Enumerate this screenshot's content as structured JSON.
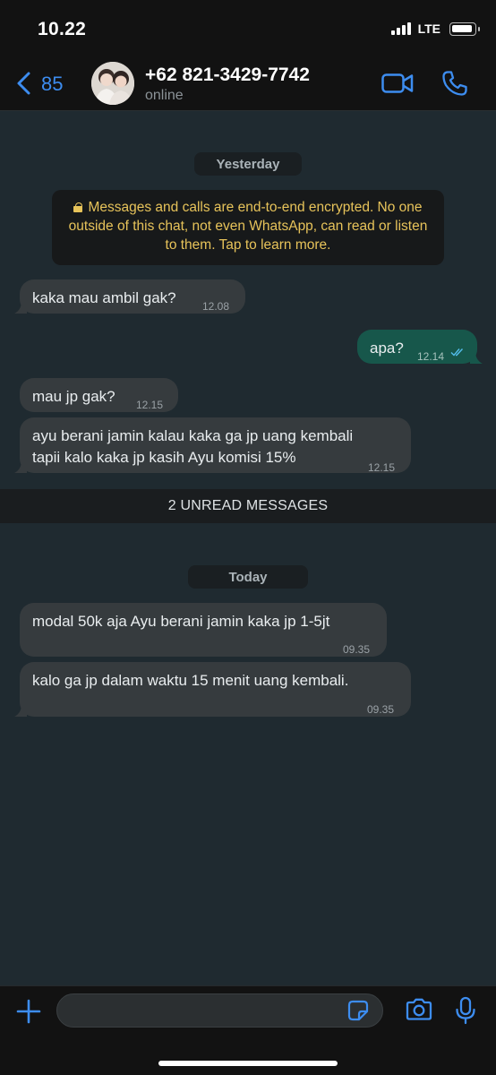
{
  "status_bar": {
    "time": "10.22",
    "network": "LTE"
  },
  "header": {
    "back_count": "85",
    "contact_name": "+62 821-3429-7742",
    "contact_status": "online",
    "icons": {
      "back": "chevron-left-icon",
      "video": "video-camera-icon",
      "call": "phone-icon"
    },
    "accent_color": "#3d8df0"
  },
  "chat": {
    "date_yesterday": "Yesterday",
    "encryption_notice": "Messages and calls are end-to-end encrypted. No one outside of this chat, not even WhatsApp, can read or listen to them. Tap to learn more.",
    "messages_yesterday": [
      {
        "direction": "in",
        "text": "kaka mau ambil gak?",
        "time": "12.08"
      },
      {
        "direction": "out",
        "text": "apa?",
        "time": "12.14",
        "status": "read"
      },
      {
        "direction": "in",
        "text": "mau jp gak?",
        "time": "12.15"
      },
      {
        "direction": "in",
        "lines": [
          "ayu berani jamin kalau kaka ga jp uang kembali",
          "tapii kalo kaka jp kasih Ayu komisi 15%"
        ],
        "time": "12.15"
      }
    ],
    "unread_banner": "2 UNREAD MESSAGES",
    "date_today": "Today",
    "messages_today": [
      {
        "direction": "in",
        "text": "modal 50k aja Ayu berani jamin kaka jp 1-5jt",
        "time": "09.35"
      },
      {
        "direction": "in",
        "text": "kalo ga jp dalam waktu 15 menit uang kembali.",
        "time": "09.35"
      }
    ],
    "colors": {
      "background": "#1f2a30",
      "incoming_bubble": "#363b3e",
      "outgoing_bubble": "#17574b",
      "read_ticks": "#53bdeb",
      "notice_text": "#e7c35a"
    }
  },
  "composer": {
    "input_value": "",
    "icons": {
      "attach": "plus-icon",
      "sticker": "sticker-icon",
      "camera": "camera-icon",
      "voice": "microphone-icon"
    }
  }
}
